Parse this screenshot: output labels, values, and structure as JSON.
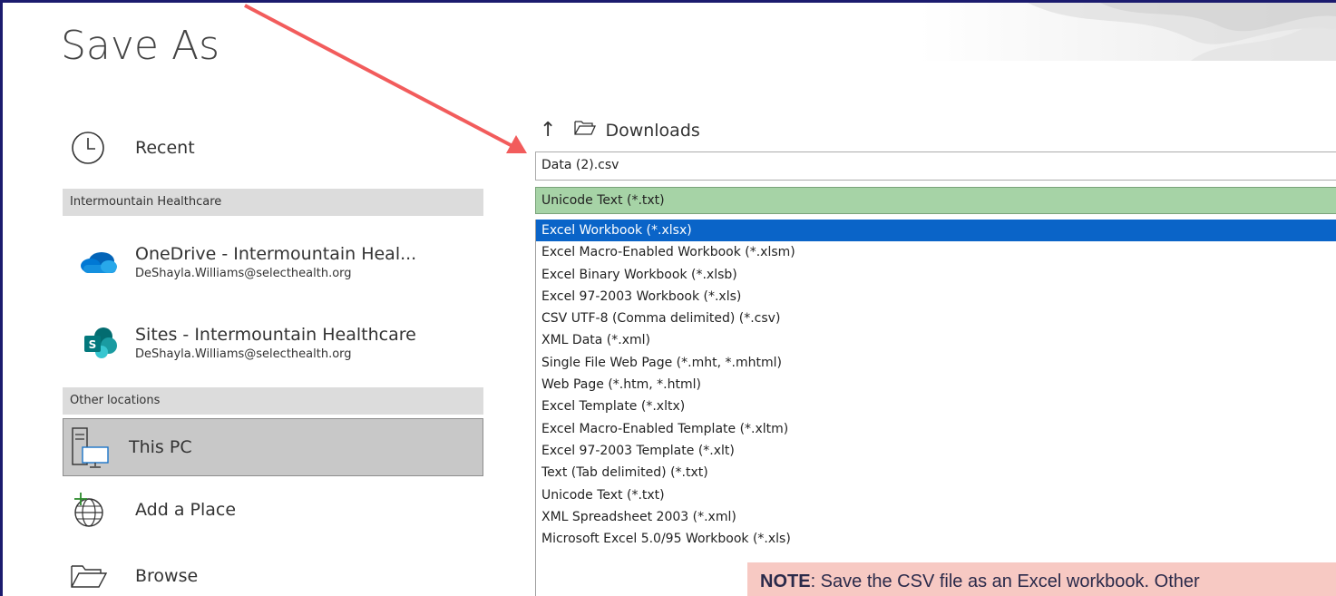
{
  "title": "Save As",
  "nav": {
    "recent": "Recent",
    "section_org": "Intermountain Healthcare",
    "onedrive": {
      "name": "OneDrive - Intermountain Heal...",
      "email": "DeShayla.Williams@selecthealth.org"
    },
    "sites": {
      "name": "Sites - Intermountain Healthcare",
      "email": "DeShayla.Williams@selecthealth.org"
    },
    "section_other": "Other locations",
    "this_pc": "This PC",
    "add_place": "Add a Place",
    "browse": "Browse"
  },
  "location": {
    "folder": "Downloads"
  },
  "filename": "Data (2).csv",
  "filetype_selected": "Unicode Text (*.txt)",
  "filetype_options": [
    "Excel Workbook (*.xlsx)",
    "Excel Macro-Enabled Workbook (*.xlsm)",
    "Excel Binary Workbook (*.xlsb)",
    "Excel 97-2003 Workbook (*.xls)",
    "CSV UTF-8 (Comma delimited) (*.csv)",
    "XML Data (*.xml)",
    "Single File Web Page (*.mht, *.mhtml)",
    "Web Page (*.htm, *.html)",
    "Excel Template (*.xltx)",
    "Excel Macro-Enabled Template (*.xltm)",
    "Excel 97-2003 Template (*.xlt)",
    "Text (Tab delimited) (*.txt)",
    "Unicode Text (*.txt)",
    "XML Spreadsheet 2003 (*.xml)",
    "Microsoft Excel 5.0/95 Workbook (*.xls)"
  ],
  "highlighted_option_index": 0,
  "note": {
    "label": "NOTE",
    "text": ": Save the CSV file as an Excel workbook. Other"
  },
  "colors": {
    "accent_selected": "#0a64c8",
    "filetype_bg": "#a6d3a6",
    "note_bg": "#f7c9c3",
    "arrow": "#f25c5c"
  }
}
